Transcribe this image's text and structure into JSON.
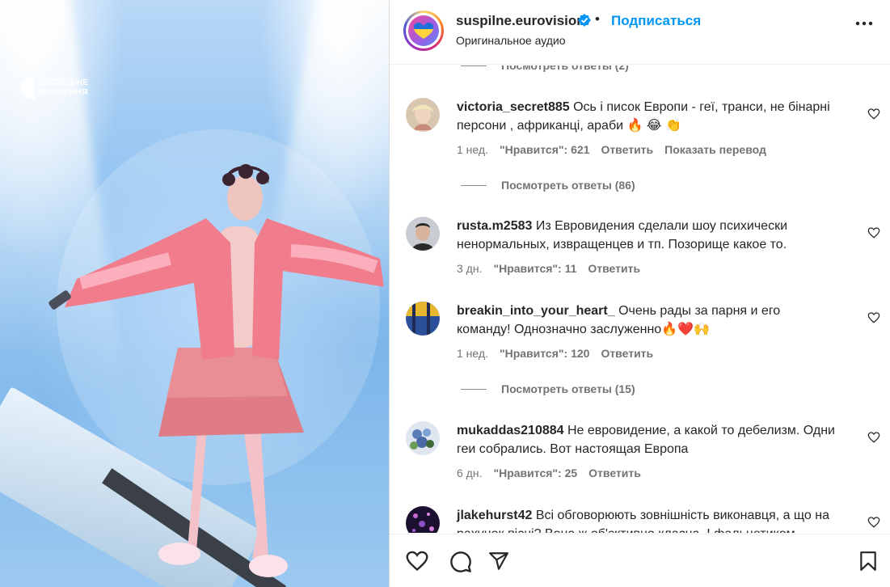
{
  "media": {
    "logo_line1": "СУСПІЛЬНЕ",
    "logo_line2": "МОВЛЕННЯ"
  },
  "header": {
    "username": "suspilne.eurovision",
    "dot": "•",
    "follow": "Подписаться",
    "audio": "Оригинальное аудио"
  },
  "comments": {
    "top_replies": "Посмотреть ответы (2)",
    "items": [
      {
        "user": "victoria_secret885",
        "text": "Ось і писок Европи - геї, транси, не бінарні персони , африканці, араби 🔥 😂 👏",
        "time": "1 нед.",
        "likes": "\"Нравится\": 621",
        "reply": "Ответить",
        "translate": "Показать перевод",
        "replies": "Посмотреть ответы (86)"
      },
      {
        "user": "rusta.m2583",
        "text": "Из Евровидения сделали шоу психически ненормальных, извращенцев и тп. Позорище какое то.",
        "time": "3 дн.",
        "likes": "\"Нравится\": 11",
        "reply": "Ответить"
      },
      {
        "user": "breakin_into_your_heart_",
        "text": "Очень рады за парня и его команду! Однозначно заслуженно🔥❤️🙌",
        "time": "1 нед.",
        "likes": "\"Нравится\": 120",
        "reply": "Ответить",
        "replies": "Посмотреть ответы (15)"
      },
      {
        "user": "mukaddas210884",
        "text": "Не евровидение, а какой то дебелизм. Одни геи собрались. Вот настоящая Европа",
        "time": "6 дн.",
        "likes": "\"Нравится\": 25",
        "reply": "Ответить"
      },
      {
        "user": "jlakehurst42",
        "text": "Всі обговорюють зовнішність виконавця, а що на рахунок пісні? Вона ж об'єктивно класна. І фальцетиком"
      }
    ]
  },
  "colors": {
    "accent": "#0095f6",
    "muted": "#737373",
    "text": "#262626"
  }
}
